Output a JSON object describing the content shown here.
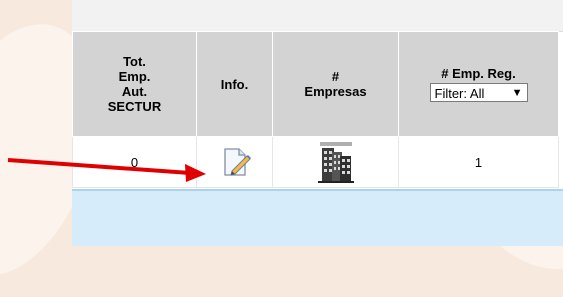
{
  "table": {
    "headers": {
      "tot_emp": [
        "Tot.",
        "Emp.",
        "Aut.",
        "SECTUR"
      ],
      "info": "Info.",
      "empresas": [
        "#",
        "Empresas"
      ],
      "emp_reg": "# Emp. Reg."
    },
    "filter": {
      "selected": "Filter: All",
      "caret": "▼"
    },
    "row": {
      "tot_emp_value": "0",
      "emp_reg_value": "1"
    }
  },
  "icons": {
    "info": "edit-document-icon",
    "empresas": "buildings-icon"
  },
  "colors": {
    "header_bg": "#d3d3d3",
    "band": "#d6ecfa",
    "arrow": "#e00000",
    "page_bg": "#f7e9dd"
  },
  "top_strip_text": "' ' '"
}
